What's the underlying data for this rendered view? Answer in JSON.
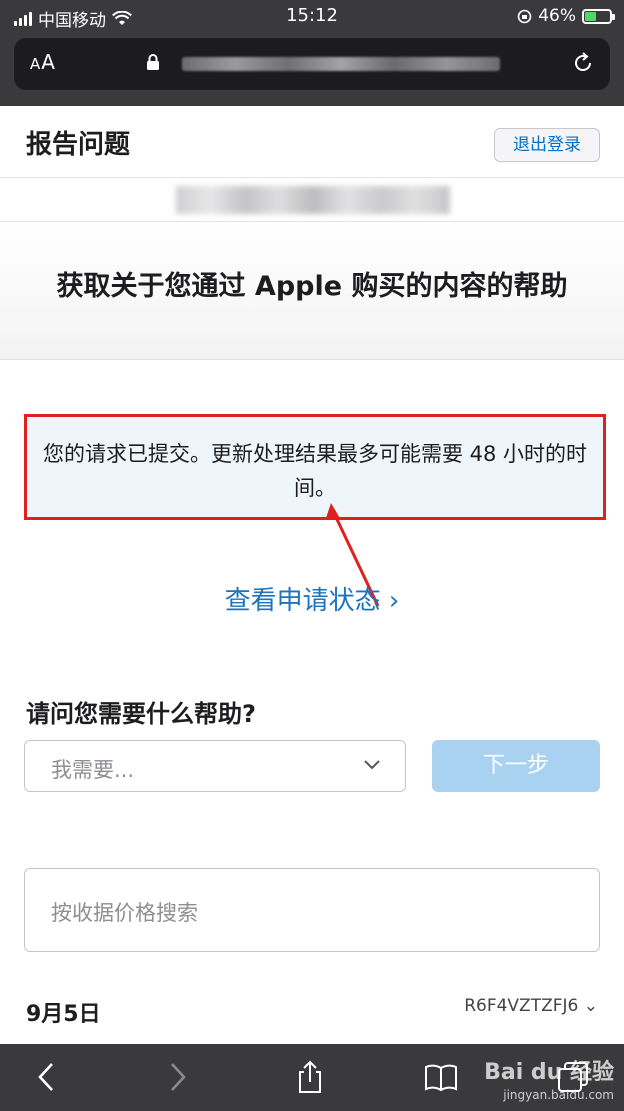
{
  "status_bar": {
    "carrier": "中国移动",
    "time": "15:12",
    "battery": "46%",
    "battery_fraction": 0.46
  },
  "browser": {
    "text_size_label": "AA"
  },
  "header": {
    "title": "报告问题",
    "logout_label": "退出登录"
  },
  "hero": {
    "title": "获取关于您通过 Apple 购买的内容的帮助"
  },
  "notice": {
    "text": "您的请求已提交。更新处理结果最多可能需要 48 小时的时间。"
  },
  "status_link": {
    "label": "查看申请状态 ›"
  },
  "help": {
    "question": "请问您需要什么帮助?",
    "select_placeholder": "我需要...",
    "next_label": "下一步"
  },
  "search": {
    "placeholder": "按收据价格搜索"
  },
  "receipt": {
    "date": "9月5日",
    "order_id": "R6F4VZTZFJ6 ⌄"
  },
  "watermark": {
    "brand": "Bai du 经验",
    "site": "jingyan.baidu.com"
  },
  "colors": {
    "accent": "#1e73be",
    "highlight_border": "#e02020",
    "next_disabled": "#a9d2f1",
    "battery": "#4cd964"
  }
}
